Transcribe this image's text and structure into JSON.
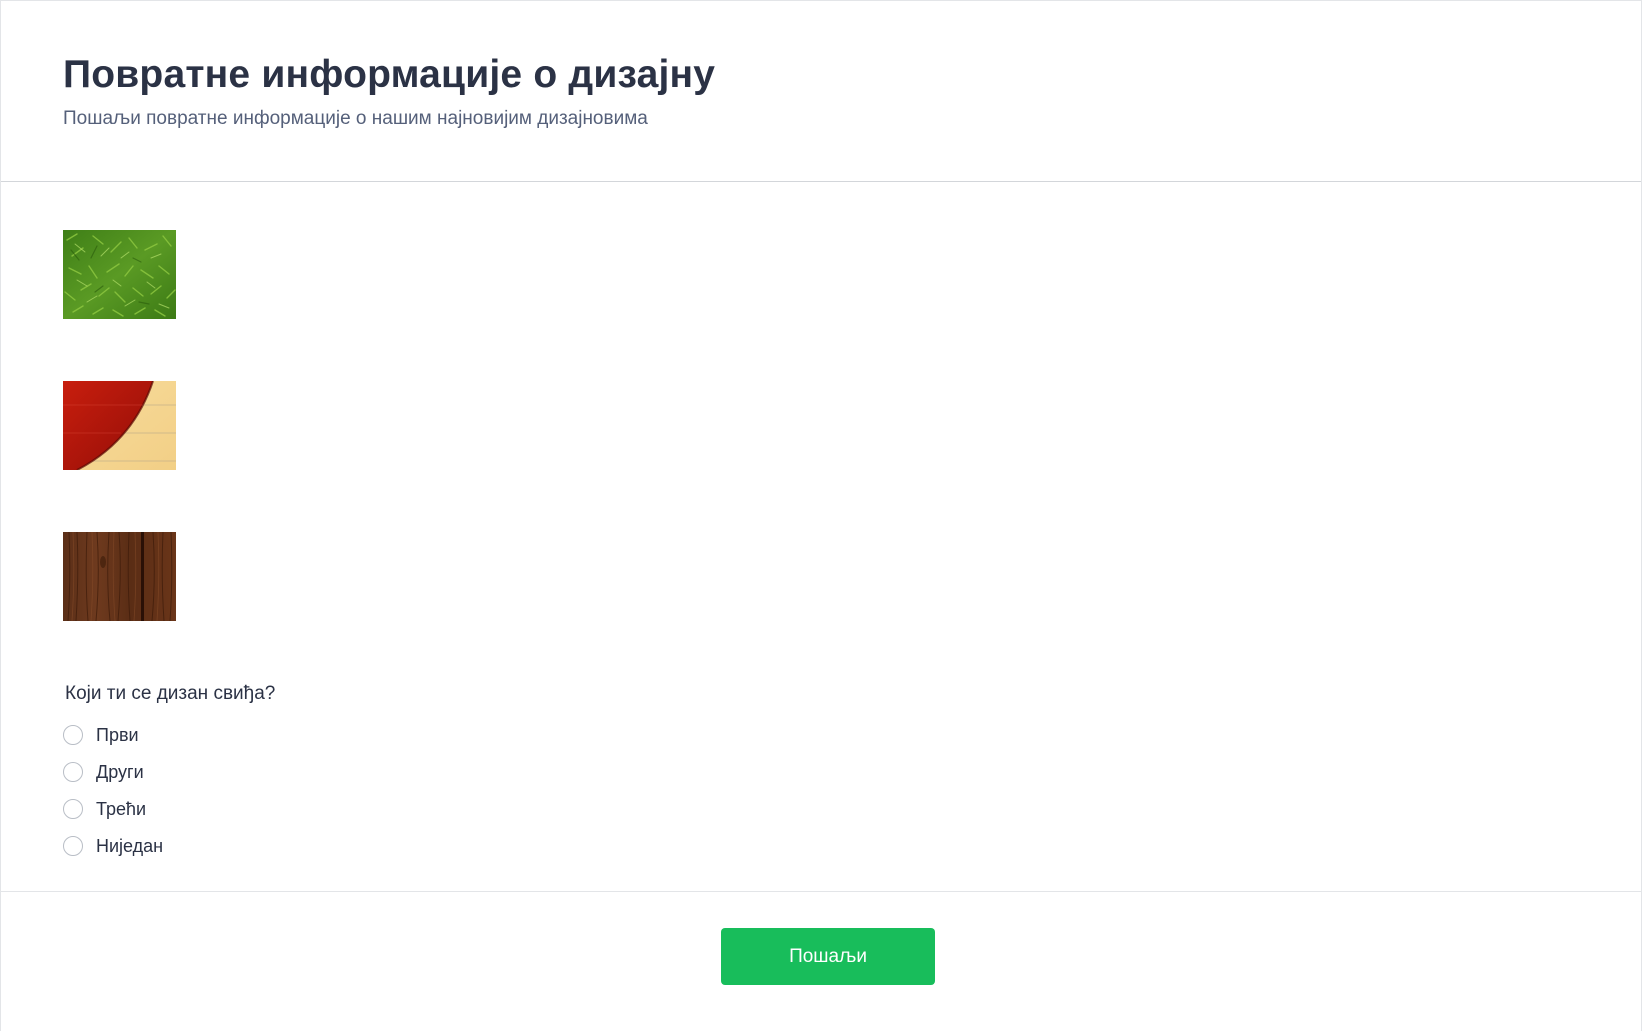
{
  "form": {
    "title": "Повратне информације о дизајну",
    "subtitle": "Пошаљи повратне информације о нашим најновијим дизајновима"
  },
  "images": [
    {
      "icon": "grass-texture-image"
    },
    {
      "icon": "red-notebook-cover-image"
    },
    {
      "icon": "dark-wood-texture-image"
    }
  ],
  "question": {
    "label": "Који ти се дизан свиђа?",
    "options": [
      {
        "label": "Први",
        "selected": false
      },
      {
        "label": "Други",
        "selected": false
      },
      {
        "label": "Трећи",
        "selected": false
      },
      {
        "label": "Ниједан",
        "selected": false
      }
    ]
  },
  "submit": {
    "label": "Пошаљи"
  },
  "colors": {
    "title": "#2b3245",
    "subtitle": "#55607a",
    "submit_button": "#18bd5b",
    "radio_border": "#b9bec6"
  }
}
